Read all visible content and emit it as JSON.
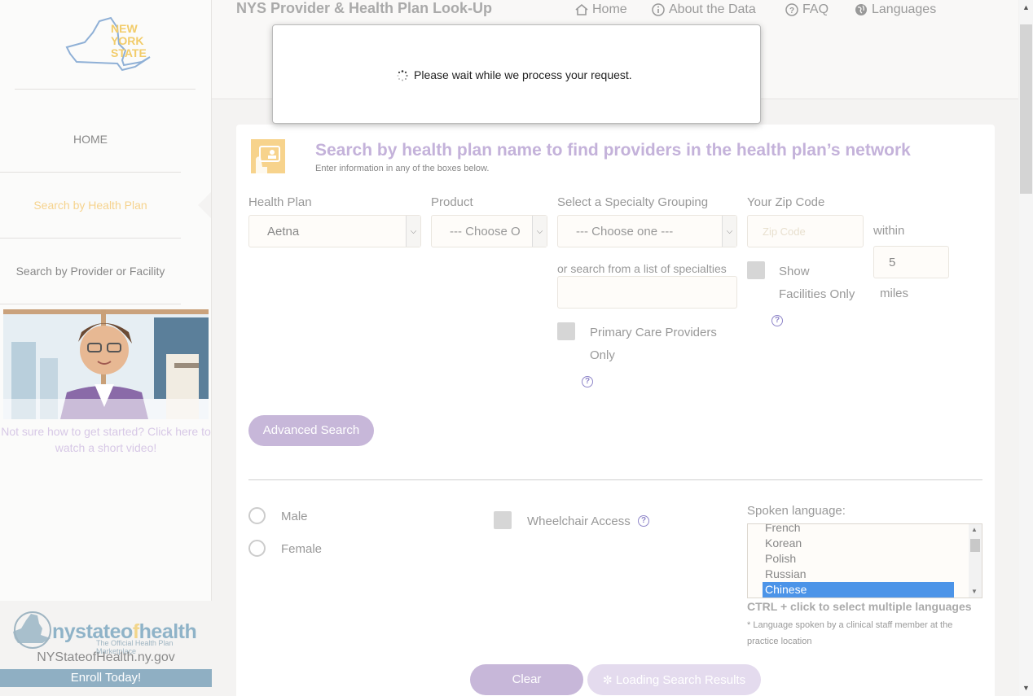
{
  "header": {
    "title": "NYS Provider & Health Plan Look-Up",
    "nav": {
      "home": "Home",
      "about": "About the Data",
      "faq": "FAQ",
      "languages": "Languages"
    }
  },
  "sidebar": {
    "logo_text": [
      "NEW",
      "YORK",
      "STATE"
    ],
    "items": [
      {
        "label": "HOME"
      },
      {
        "label": "Search by Health Plan"
      },
      {
        "label": "Search by Provider or Facility"
      }
    ],
    "video_caption": "Not sure how to get started? Click here to watch a short video!",
    "nysoh": {
      "brand_pre": "nystateo",
      "brand_mid": "f",
      "brand_post": "health",
      "tagline": "The Official Health Plan Marketplace",
      "url": "NYStateofHealth.ny.gov",
      "enroll": "Enroll Today!"
    }
  },
  "modal": {
    "message": "Please wait while we process your request."
  },
  "search": {
    "title": "Search by health plan name to find providers in the health plan’s network",
    "subtitle": "Enter information in any of the boxes below.",
    "health_plan": {
      "label": "Health Plan",
      "value": "Aetna"
    },
    "product": {
      "label": "Product",
      "value": "--- Choose O"
    },
    "specialty": {
      "label": "Select a Specialty Grouping",
      "value": "--- Choose one ---",
      "list_label": "or search from a list of specialties"
    },
    "zip": {
      "label": "Your Zip Code",
      "placeholder": "Zip Code",
      "within": "within",
      "miles_value": "5",
      "miles": "miles"
    },
    "facilities_only": "Show Facilities Only",
    "facilities_line1": "Show",
    "facilities_line2": "Facilities Only",
    "pcp_line1": "Primary Care Providers",
    "pcp_line2": "Only",
    "advanced": "Advanced Search",
    "gender": {
      "male": "Male",
      "female": "Female"
    },
    "wheelchair": "Wheelchair Access",
    "language": {
      "label": "Spoken language:",
      "options": [
        "French",
        "Korean",
        "Polish",
        "Russian",
        "Chinese"
      ],
      "selected": "Chinese",
      "hint": "CTRL + click to select multiple languages",
      "note": "* Language spoken by a clinical staff member at the practice location"
    },
    "clear": "Clear",
    "loading": "Loading Search Results"
  },
  "colors": {
    "accent_purple": "#c7b7d9",
    "accent_yellow": "#f7d38c",
    "selection_blue": "#4c94e8"
  }
}
